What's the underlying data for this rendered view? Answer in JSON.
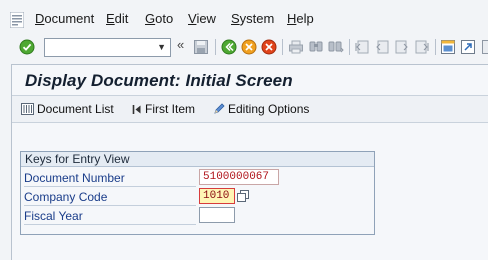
{
  "menu": {
    "items": [
      {
        "label": "Document",
        "mnemonic": "D",
        "rest": "ocument"
      },
      {
        "label": "Edit",
        "mnemonic": "E",
        "rest": "dit"
      },
      {
        "label": "Goto",
        "mnemonic": "G",
        "rest": "oto"
      },
      {
        "label": "View",
        "mnemonic": "V",
        "rest": "iew"
      },
      {
        "label": "System",
        "mnemonic": "S",
        "rest": "ystem"
      },
      {
        "label": "Help",
        "mnemonic": "H",
        "rest": "elp"
      }
    ]
  },
  "toolbar": {
    "command_field": {
      "value": ""
    },
    "icons": [
      "enter-icon",
      "back-icon",
      "exit-icon",
      "cancel-icon",
      "save-icon",
      "print-icon",
      "find-icon",
      "find-next-icon",
      "first-page-icon",
      "previous-page-icon",
      "next-page-icon",
      "last-page-icon",
      "create-session-icon",
      "shortcut-icon"
    ]
  },
  "screen": {
    "title": "Display Document: Initial Screen",
    "app_toolbar": {
      "document_list": "Document List",
      "first_item": "First Item",
      "editing_options": "Editing Options"
    }
  },
  "keys_group": {
    "title": "Keys for Entry View",
    "fields": [
      {
        "label": "Document Number",
        "value": "5100000067"
      },
      {
        "label": "Company Code",
        "value": "1010"
      },
      {
        "label": "Fiscal Year",
        "value": ""
      }
    ]
  },
  "colors": {
    "title_text": "#142030",
    "label_text": "#1a3d8a",
    "value_text": "#b0141b",
    "focus_bg": "#fff5b5"
  }
}
